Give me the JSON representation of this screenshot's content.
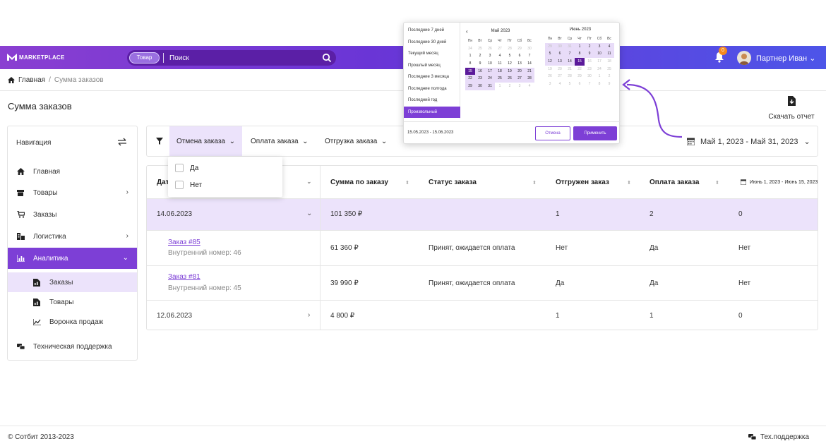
{
  "header": {
    "logo_text": "MARKETPLACE",
    "search_chip": "Товар",
    "search_placeholder": "Поиск",
    "notification_count": "0",
    "user_name": "Партнер Иван"
  },
  "breadcrumb": {
    "home": "Главная",
    "separator": "/",
    "current": "Сумма заказов"
  },
  "page": {
    "title": "Сумма заказов",
    "download_label": "Скачать отчет"
  },
  "sidebar": {
    "title": "Навигация",
    "items": [
      {
        "label": "Главная",
        "icon": "home-icon"
      },
      {
        "label": "Товары",
        "icon": "goods-icon"
      },
      {
        "label": "Заказы",
        "icon": "cart-icon"
      },
      {
        "label": "Логистика",
        "icon": "logistics-icon"
      },
      {
        "label": "Аналитика",
        "icon": "analytics-icon"
      },
      {
        "label": "Заказы",
        "icon": "report-icon"
      },
      {
        "label": "Товары",
        "icon": "report-icon"
      },
      {
        "label": "Воронка продаж",
        "icon": "funnel-chart-icon"
      },
      {
        "label": "Техническая поддержка",
        "icon": "support-icon"
      }
    ]
  },
  "filters": {
    "tabs": [
      "Отмена заказа",
      "Оплата заказа",
      "Отгрузка заказа"
    ],
    "date_range": "Май 1, 2023 - Май 31, 2023",
    "dropdown_options": [
      "Да",
      "Нет"
    ]
  },
  "table": {
    "headers": [
      "Дат",
      "Сумма по заказу",
      "Статус заказа",
      "Отгружен заказ",
      "Оплата заказа"
    ],
    "extra_range": "Июнь 1, 2023 - Июнь 15, 2023",
    "rows": [
      {
        "date": "14.06.2023",
        "sum": "101 350 ₽",
        "status": "",
        "shipped": "1",
        "paid": "2",
        "extra": "0"
      },
      {
        "order": "Заказ #85",
        "internal": "Внутренний номер: 46",
        "sum": "61 360 ₽",
        "status": "Принят, ожидается оплата",
        "shipped": "Нет",
        "paid": "Да",
        "extra": "Нет"
      },
      {
        "order": "Заказ #81",
        "internal": "Внутренний номер: 45",
        "sum": "39 990 ₽",
        "status": "Принят, ожидается оплата",
        "shipped": "Да",
        "paid": "Да",
        "extra": "Нет"
      },
      {
        "date": "12.06.2023",
        "sum": "4 800 ₽",
        "status": "",
        "shipped": "1",
        "paid": "1",
        "extra": "0"
      }
    ]
  },
  "calendar": {
    "presets": [
      "Последние 7 дней",
      "Последние 30 дней",
      "Текущий месяц",
      "Прошлый месяц",
      "Последние 3 месяца",
      "Последние полгода",
      "Последний год",
      "Произвольный"
    ],
    "prev_arrow": "‹",
    "weekdays": [
      "Пн",
      "Вт",
      "Ср",
      "Чт",
      "Пт",
      "Сб",
      "Вс"
    ],
    "left_month": "Май 2023",
    "right_month": "Июнь 2023",
    "left_days": [
      "24",
      "25",
      "26",
      "27",
      "28",
      "29",
      "30",
      "1",
      "2",
      "3",
      "4",
      "5",
      "6",
      "7",
      "8",
      "9",
      "10",
      "11",
      "12",
      "13",
      "14",
      "15",
      "16",
      "17",
      "18",
      "19",
      "20",
      "21",
      "22",
      "23",
      "24",
      "25",
      "26",
      "27",
      "28",
      "29",
      "30",
      "31",
      "1",
      "2",
      "3",
      "4"
    ],
    "right_days": [
      "29",
      "30",
      "31",
      "1",
      "2",
      "3",
      "4",
      "5",
      "6",
      "7",
      "8",
      "9",
      "10",
      "11",
      "12",
      "13",
      "14",
      "15",
      "16",
      "17",
      "18",
      "19",
      "20",
      "21",
      "22",
      "23",
      "24",
      "25",
      "26",
      "27",
      "28",
      "29",
      "30",
      "1",
      "2",
      "3",
      "4",
      "5",
      "6",
      "7",
      "8",
      "9"
    ],
    "range_text": "15.05.2023 - 15.06.2023",
    "cancel": "Отмена",
    "apply": "Применить"
  },
  "footer": {
    "copyright": "© Сотбит 2013-2023",
    "support": "Тех.поддержка"
  },
  "colors": {
    "accent": "#7d3fd6",
    "dark_accent": "#5b1a9a",
    "light_accent": "#ece3fb",
    "badge": "#f58a1f"
  }
}
